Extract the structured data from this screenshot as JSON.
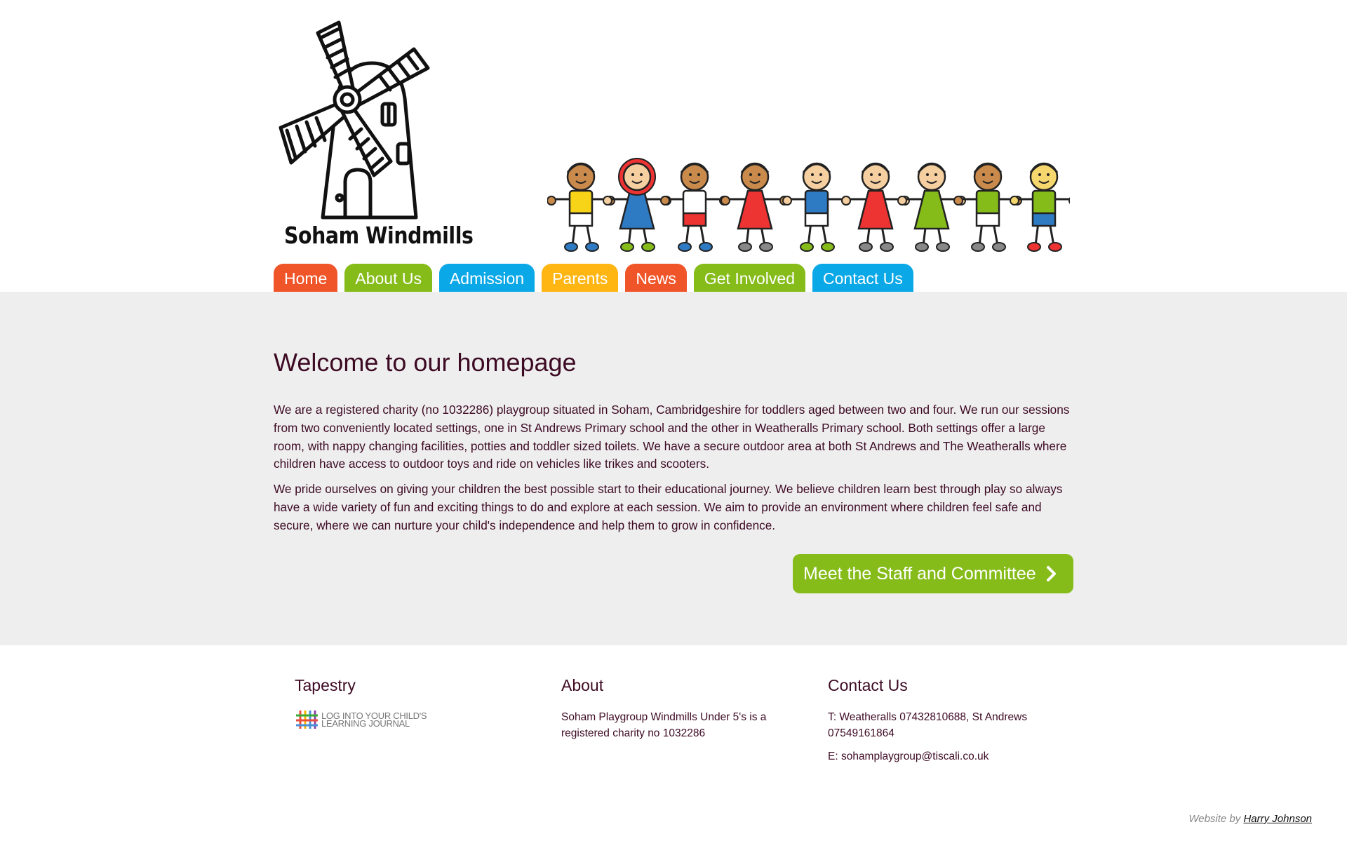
{
  "header": {
    "logo_text": "Soham Windmills"
  },
  "nav": {
    "items": [
      {
        "label": "Home",
        "color": "#f0552a"
      },
      {
        "label": "About Us",
        "color": "#86bc1a"
      },
      {
        "label": "Admission",
        "color": "#0ba8e7"
      },
      {
        "label": "Parents",
        "color": "#ffb512"
      },
      {
        "label": "News",
        "color": "#f0552a"
      },
      {
        "label": "Get Involved",
        "color": "#86bc1a"
      },
      {
        "label": "Contact Us",
        "color": "#0ba8e7"
      }
    ]
  },
  "main": {
    "title": "Welcome to our homepage",
    "paragraphs": [
      "We are a registered charity (no 1032286) playgroup situated in Soham, Cambridgeshire for toddlers aged between two and four. We run our sessions from two conveniently located settings, one in St Andrews Primary school and the other in Weatheralls Primary school. Both settings offer a large room, with nappy changing facilities, potties and toddler sized toilets. We have a secure outdoor area at both St Andrews and The Weatheralls where children have access to outdoor toys and ride on vehicles like trikes and scooters.",
      "We pride ourselves on giving your children the best possible start to their educational journey. We believe children learn best through play so always have a wide variety of fun and exciting things to do and explore at each session. We aim to provide an environment where children feel safe and secure, where we can nurture your child's independence and help them to grow in confidence."
    ],
    "cta_label": "Meet the Staff and Committee",
    "cta_color": "#86bc1a"
  },
  "footer": {
    "tapestry": {
      "heading": "Tapestry",
      "link_text": "LOG INTO YOUR CHILD'S LEARNING JOURNAL"
    },
    "about": {
      "heading": "About",
      "text": "Soham Playgroup Windmills Under 5's is a registered charity no 1032286"
    },
    "contact": {
      "heading": "Contact Us",
      "phone": "T: Weatheralls 07432810688, St Andrews 07549161864",
      "email": "E: sohamplaygroup@tiscali.co.uk"
    },
    "credit_prefix": "Website by",
    "credit_name": "Harry Johnson"
  },
  "colors": {
    "text": "#3d0a23",
    "main_bg": "#eeeeee"
  }
}
